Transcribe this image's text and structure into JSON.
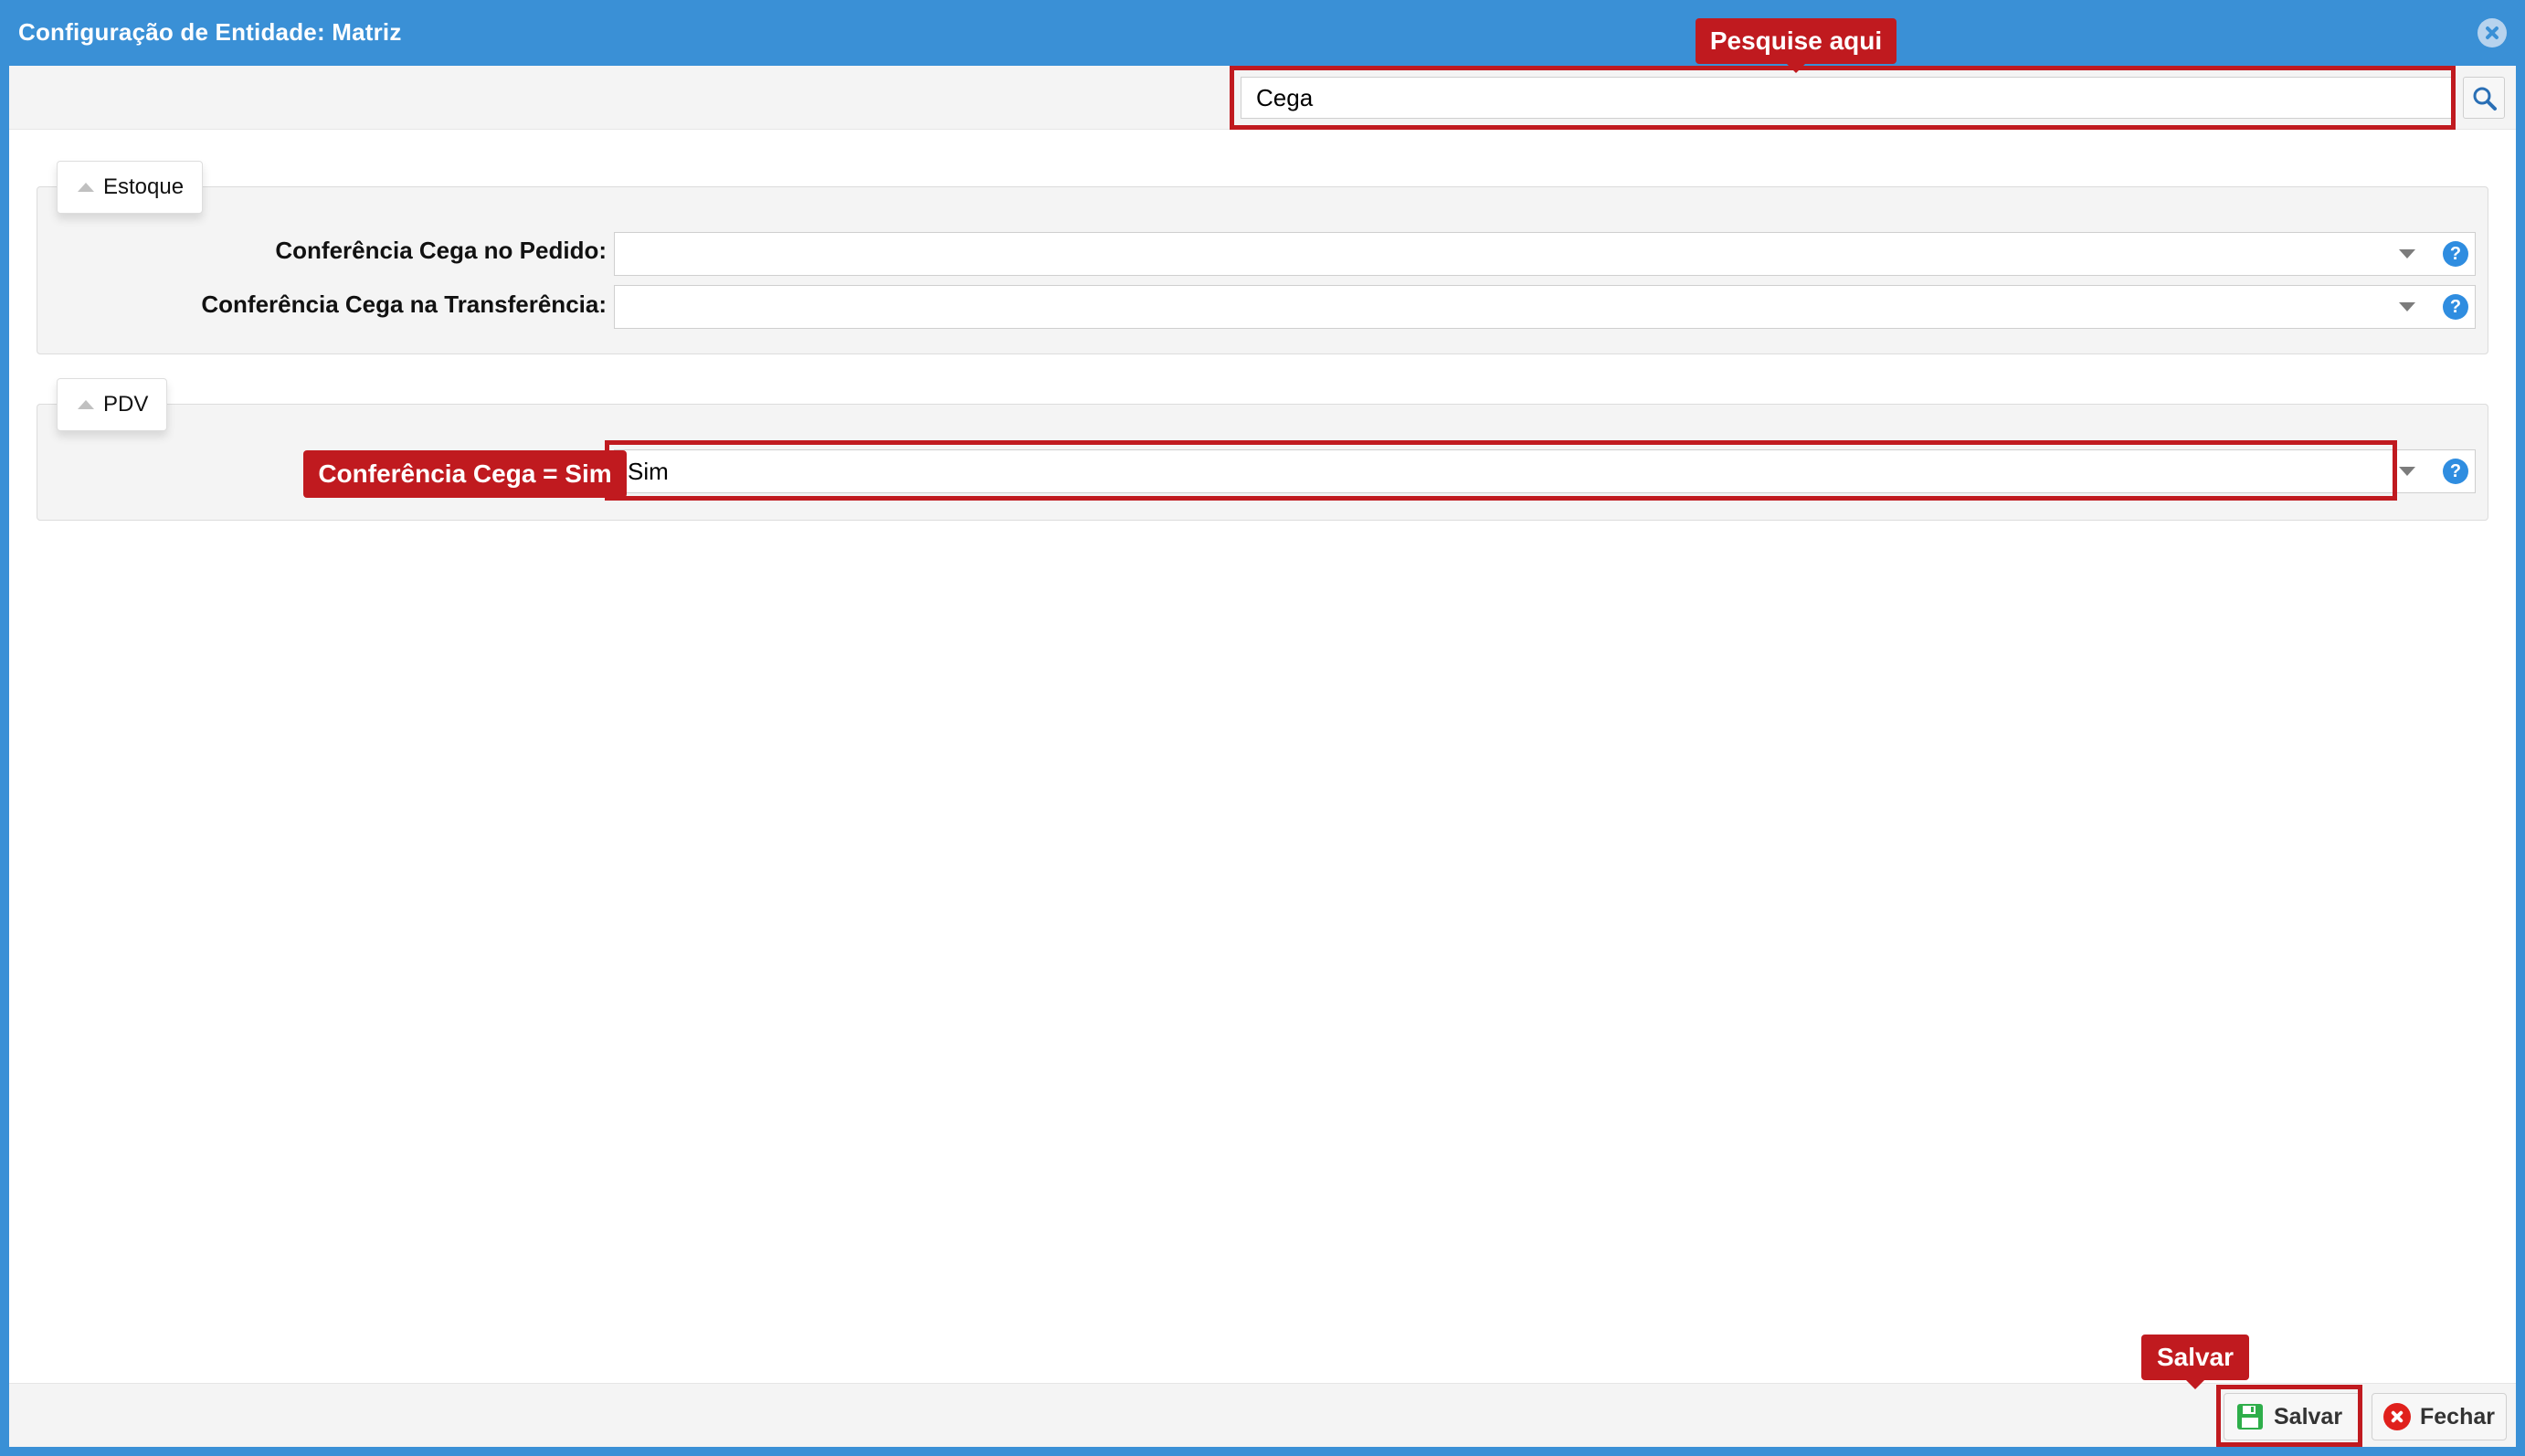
{
  "window": {
    "title": "Configuração de Entidade: Matriz",
    "close_icon": "close-circle-icon"
  },
  "search": {
    "value": "Cega",
    "button_icon": "search-icon"
  },
  "sections": [
    {
      "legend": "Estoque",
      "fields": [
        {
          "label": "Conferência Cega no Pedido:",
          "value": ""
        },
        {
          "label": "Conferência Cega na Transferência:",
          "value": ""
        }
      ]
    },
    {
      "legend": "PDV",
      "fields": [
        {
          "label": "",
          "value": "Sim"
        }
      ]
    }
  ],
  "help_glyph": "?",
  "footer": {
    "save_label": "Salvar",
    "close_label": "Fechar"
  },
  "annotations": {
    "search_callout": "Pesquise aqui",
    "field_callout": "Conferência Cega = Sim",
    "save_callout": "Salvar",
    "highlight_color": "#c01a1f"
  },
  "colors": {
    "titlebar": "#3a90d6",
    "help": "#2f8de0",
    "save_icon": "#2eae4a",
    "close_icon": "#e0201c"
  }
}
